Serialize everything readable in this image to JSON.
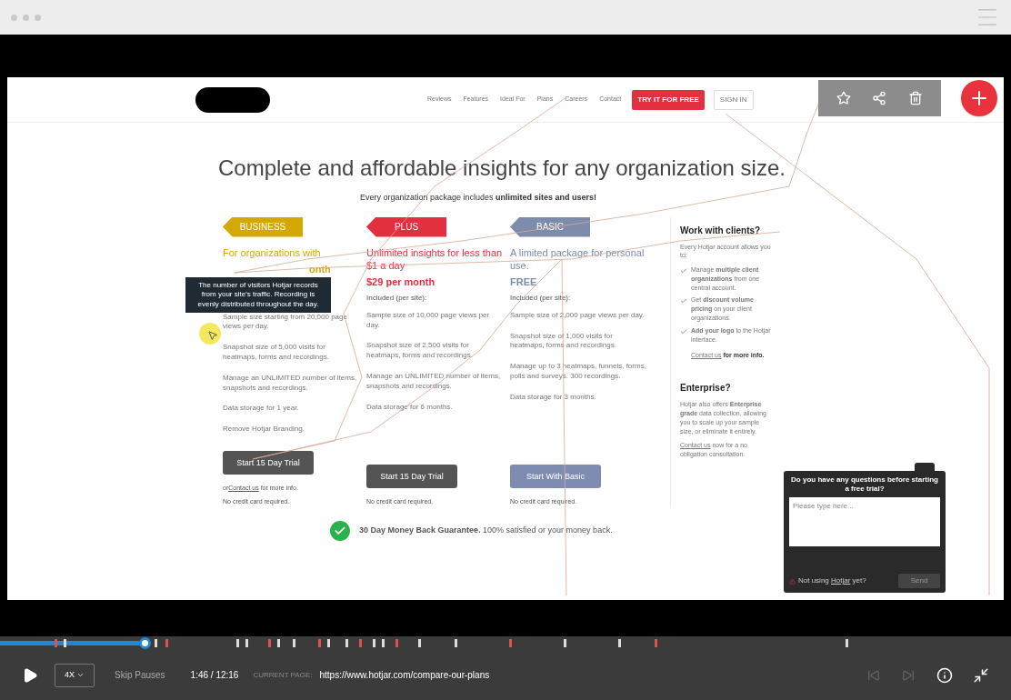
{
  "nav": {
    "links": [
      "Reviews",
      "Features",
      "Ideal For",
      "Plans",
      "Careers",
      "Contact"
    ],
    "cta": "TRY IT FOR FREE",
    "sign_in": "SIGN IN"
  },
  "headline": "Complete and affordable insights for any organization size.",
  "subheadline": "Every organization package includes **unlimited sites and users!**",
  "plans": [
    {
      "badge": "BUSINESS",
      "color": "#d4a800",
      "kind": "paid",
      "tagline": "For organizations with",
      "price": "onth",
      "features": [
        "Sample size starting from 20,000 page views per day.",
        "Snapshot size of 5,000 visits for heatmaps, forms and recordings.",
        "Manage an UNLIMITED number of items, snapshots and recordings.",
        "Data storage for 1 year.",
        "Remove Hotjar Branding."
      ],
      "button": "Start 15 Day Trial",
      "notes": [
        {
          "before": "or ",
          "link": "Contact us",
          "after": " for more info."
        },
        {
          "before": "No credit card required."
        }
      ]
    },
    {
      "badge": "PLUS",
      "color": "#e2303f",
      "kind": "paid",
      "tagline": "Unlimited insights for less than $1 a day",
      "price": "$29 per month",
      "included": "Included (per site):",
      "features": [
        "Sample size of 10,000 page views per day.",
        "Snapshot size of 2,500 visits for heatmaps, forms and recordings.",
        "Manage an UNLIMITED number of items, snapshots and recordings.",
        "Data storage for 6 months."
      ],
      "button": "Start 15 Day Trial",
      "notes": [
        {
          "before": "No credit card required."
        }
      ]
    },
    {
      "badge": "BASIC",
      "color": "#7d8cab",
      "kind": "free",
      "tagline": "A limited package for personal use.",
      "price": "FREE",
      "included": "Included (per site):",
      "features": [
        "Sample size of 2,000 page views per day.",
        "Snapshot size of 1,000 visits for heatmaps, forms and recordings.",
        "Manage up to 3 heatmaps, funnels, forms, polls and surveys. 300 recordings.",
        "Data storage for 3 months."
      ],
      "button": "Start With Basic",
      "notes": [
        {
          "before": "No credit card required."
        }
      ]
    }
  ],
  "tooltip": "The number of visitors Hotjar records from your site's traffic. Recording is evenly distributed throughout the day.",
  "clients": {
    "title": "Work with clients?",
    "intro": "Every Hotjar account allows you to:",
    "items": [
      "Manage **multiple client organizations** from one central account.",
      "Get **discount volume pricing** on your client organizations.",
      "**Add your logo** to the Hotjar interface."
    ],
    "link": "Contact us",
    "after": " for more info."
  },
  "enterprise": {
    "title": "Enterprise?",
    "text": "Hotjar also offers **Enterprise grade** data collection, allowing you to scale up your sample size, or eliminate it entirely.",
    "link": "Contact us",
    "after": " now for a no obligation consultation."
  },
  "guarantee": "**30 Day Money Back Guarantee.** 100% satisfied or your money back.",
  "chat": {
    "title": "Do you have any questions before starting a free trial?",
    "placeholder": "Please type here...",
    "footer_before": "Not using ",
    "footer_link": "Hotjar",
    "footer_after": " yet?",
    "send": "Send"
  },
  "player": {
    "progress": {
      "level": 0.143
    },
    "speed": "4X",
    "skip": "Skip Pauses",
    "time": "1:46 / 12:16",
    "page_label": "CURRENT PAGE:",
    "url": "https://www.hotjar.com/compare-our-plans"
  }
}
